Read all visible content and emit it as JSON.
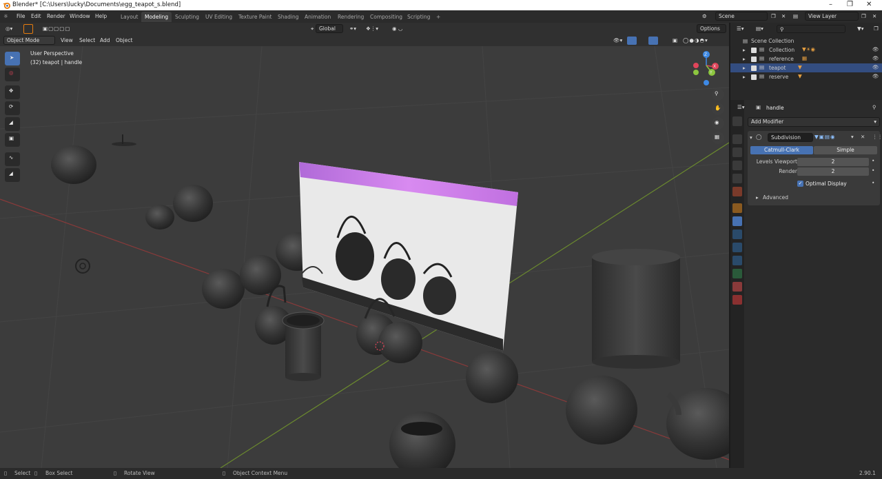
{
  "window": {
    "title": "Blender* [C:\\Users\\lucky\\Documents\\egg_teapot_s.blend]",
    "min": "–",
    "max": "❐",
    "close": "✕"
  },
  "menu": [
    "File",
    "Edit",
    "Render",
    "Window",
    "Help"
  ],
  "workspaces": [
    "Layout",
    "Modeling",
    "Sculpting",
    "UV Editing",
    "Texture Paint",
    "Shading",
    "Animation",
    "Rendering",
    "Compositing",
    "Scripting",
    "+"
  ],
  "active_workspace": "Modeling",
  "scene": {
    "label": "Scene",
    "view_layer": "View Layer"
  },
  "tool_header": {
    "orientation": "Global",
    "options": "Options"
  },
  "viewport_header": {
    "mode": "Object Mode",
    "view": "View",
    "select": "Select",
    "add": "Add",
    "object": "Object"
  },
  "viewport": {
    "perspective": "User Perspective",
    "info": "(32) teapot | handle",
    "gizmo": {
      "x": "X",
      "y": "Y",
      "z": "Z"
    }
  },
  "outliner": {
    "root": "Scene Collection",
    "items": [
      {
        "name": "Collection",
        "selected": false
      },
      {
        "name": "reference",
        "selected": false
      },
      {
        "name": "teapot",
        "selected": true
      },
      {
        "name": "reserve",
        "selected": false
      }
    ]
  },
  "properties": {
    "object_name": "handle",
    "add_modifier": "Add Modifier",
    "modifier": {
      "name": "Subdivision",
      "type_options": [
        "Catmull-Clark",
        "Simple"
      ],
      "active_type": "Catmull-Clark",
      "levels_viewport_label": "Levels Viewport",
      "levels_viewport": "2",
      "render_label": "Render",
      "render": "2",
      "optimal_display_label": "Optimal Display",
      "optimal_display": true,
      "advanced": "Advanced"
    }
  },
  "statusbar": {
    "select": "Select",
    "box_select": "Box Select",
    "rotate": "Rotate View",
    "context": "Object Context Menu",
    "version": "2.90.1"
  },
  "colors": {
    "accent": "#4772b3",
    "selected_row": "#334d80",
    "viewport_bg": "#3c3c3c",
    "x_axis": "#e0455a",
    "y_axis": "#8cc63f",
    "z_axis": "#3e8ae6"
  }
}
